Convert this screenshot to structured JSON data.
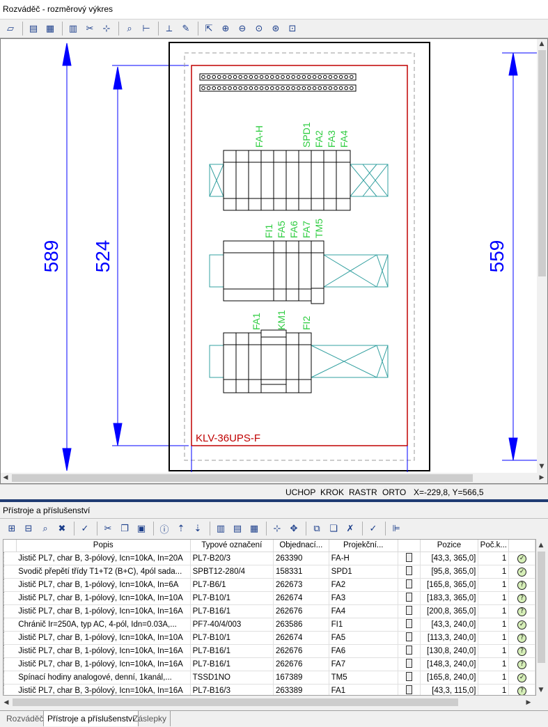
{
  "window": {
    "title": "Rozváděč - rozměrový výkres"
  },
  "toolbar": {
    "icons": [
      "layers-icon",
      "print-setup-icon",
      "print-icon",
      "view-front-icon",
      "cut-icon",
      "move-icon",
      "zoom-text-icon",
      "dimension-icon",
      "measure-icon",
      "pencil-icon",
      "select-icon",
      "zoom-in-icon",
      "zoom-out-icon",
      "zoom-fit-icon",
      "zoom-window-icon",
      "zoom-all-icon"
    ]
  },
  "drawing": {
    "dim_outer_left": "589",
    "dim_inner_left": "524",
    "dim_right": "559",
    "cabinet_label": "KLV-36UPS-F",
    "row1_labels": [
      "FA-H",
      "SPD1",
      "FA2",
      "FA3",
      "FA4"
    ],
    "row2_labels": [
      "FI1",
      "FA5",
      "FA6",
      "FA7",
      "TM5"
    ],
    "row3_labels": [
      "FA1",
      "KM1",
      "FI2"
    ],
    "colors": {
      "dimension": "#0000ff",
      "panel": "#c00000",
      "labels": "#2ecc40",
      "rail": "#33a0a0"
    }
  },
  "status": {
    "snap": "UCHOP",
    "step": "KROK",
    "grid": "RASTR",
    "ortho": "ORTO",
    "coords": "X=-229,8, Y=566,5"
  },
  "panel": {
    "title": "Přístroje a příslušenství"
  },
  "table": {
    "columns": [
      "Popis",
      "Typové označení",
      "Objednací...",
      "Projekční...",
      "",
      "Pozice",
      "Poč.k...",
      ""
    ],
    "rows": [
      {
        "popis": "Jistič PL7, char B, 3-pólový, Icn=10kA, In=20A",
        "typ": "PL7-B20/3",
        "obj": "263390",
        "proj": "FA-H",
        "poz": "[43,3, 365,0]",
        "poc": "1",
        "status": "check"
      },
      {
        "popis": "Svodič přepětí třídy T1+T2 (B+C), 4pól sada...",
        "typ": "SPBT12-280/4",
        "obj": "158331",
        "proj": "SPD1",
        "poz": "[95,8, 365,0]",
        "poc": "1",
        "status": "check"
      },
      {
        "popis": "Jistič PL7, char B, 1-pólový, Icn=10kA, In=6A",
        "typ": "PL7-B6/1",
        "obj": "262673",
        "proj": "FA2",
        "poz": "[165,8, 365,0]",
        "poc": "1",
        "status": "question"
      },
      {
        "popis": "Jistič PL7, char B, 1-pólový, Icn=10kA, In=10A",
        "typ": "PL7-B10/1",
        "obj": "262674",
        "proj": "FA3",
        "poz": "[183,3, 365,0]",
        "poc": "1",
        "status": "question"
      },
      {
        "popis": "Jistič PL7, char B, 1-pólový, Icn=10kA, In=16A",
        "typ": "PL7-B16/1",
        "obj": "262676",
        "proj": "FA4",
        "poz": "[200,8, 365,0]",
        "poc": "1",
        "status": "question"
      },
      {
        "popis": "Chránič Ir=250A, typ AC, 4-pól, Idn=0.03A,...",
        "typ": "PF7-40/4/003",
        "obj": "263586",
        "proj": "FI1",
        "poz": "[43,3, 240,0]",
        "poc": "1",
        "status": "check"
      },
      {
        "popis": "Jistič PL7, char B, 1-pólový, Icn=10kA, In=10A",
        "typ": "PL7-B10/1",
        "obj": "262674",
        "proj": "FA5",
        "poz": "[113,3, 240,0]",
        "poc": "1",
        "status": "question"
      },
      {
        "popis": "Jistič PL7, char B, 1-pólový, Icn=10kA, In=16A",
        "typ": "PL7-B16/1",
        "obj": "262676",
        "proj": "FA6",
        "poz": "[130,8, 240,0]",
        "poc": "1",
        "status": "question"
      },
      {
        "popis": "Jistič PL7, char B, 1-pólový, Icn=10kA, In=16A",
        "typ": "PL7-B16/1",
        "obj": "262676",
        "proj": "FA7",
        "poz": "[148,3, 240,0]",
        "poc": "1",
        "status": "question"
      },
      {
        "popis": "Spínací hodiny analogové, denní, 1kanál,...",
        "typ": "TSSD1NO",
        "obj": "167389",
        "proj": "TM5",
        "poz": "[165,8, 240,0]",
        "poc": "1",
        "status": "check"
      },
      {
        "popis": "Jistič PL7, char B, 3-pólový, Icn=10kA, In=16A",
        "typ": "PL7-B16/3",
        "obj": "263389",
        "proj": "FA1",
        "poz": "[43,3, 115,0]",
        "poc": "1",
        "status": "question"
      }
    ]
  },
  "tabs": [
    {
      "label": "Rozváděč",
      "active": false
    },
    {
      "label": "Přístroje a příslušenství",
      "active": true
    },
    {
      "label": "Záslepky",
      "active": false
    }
  ]
}
